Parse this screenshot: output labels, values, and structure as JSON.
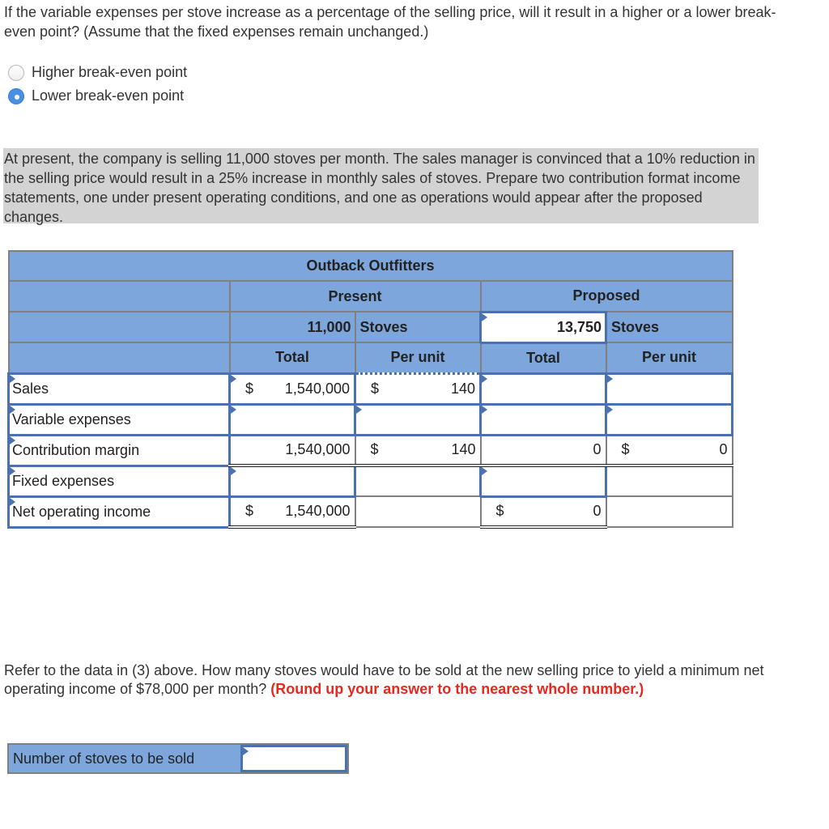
{
  "question_break_even": {
    "text": "If the variable expenses per stove increase as a percentage of the selling price, will it result in a higher or a lower break-even point? (Assume that the fixed expenses remain unchanged.)",
    "options": [
      {
        "label": "Higher break-even point",
        "selected": false
      },
      {
        "label": "Lower break-even point",
        "selected": true
      }
    ]
  },
  "instructions": "At present, the company is selling 11,000 stoves per month. The sales manager is convinced that a 10% reduction in the selling price would result in a 25% increase in monthly sales of stoves. Prepare two contribution format income statements, one under present operating conditions, and one as operations would appear after the proposed changes.",
  "income_statement": {
    "company": "Outback Outfitters",
    "present": {
      "title": "Present",
      "units": "11,000",
      "units_label": "Stoves",
      "col_total": "Total",
      "col_per_unit": "Per unit"
    },
    "proposed": {
      "title": "Proposed",
      "units": "13,750",
      "units_label": "Stoves",
      "col_total": "Total",
      "col_per_unit": "Per unit"
    },
    "currency_symbol": "$",
    "rows": [
      {
        "label": "Sales",
        "present_total": "1,540,000",
        "present_per_unit": "140",
        "proposed_total": "",
        "proposed_per_unit": ""
      },
      {
        "label": "Variable expenses",
        "present_total": "",
        "present_per_unit": "",
        "proposed_total": "",
        "proposed_per_unit": ""
      },
      {
        "label": "Contribution margin",
        "present_total": "1,540,000",
        "present_per_unit": "140",
        "proposed_total": "0",
        "proposed_per_unit": "0"
      },
      {
        "label": "Fixed expenses",
        "present_total": "",
        "present_per_unit": "",
        "proposed_total": "",
        "proposed_per_unit": ""
      },
      {
        "label": "Net operating income",
        "present_total": "1,540,000",
        "present_per_unit": "",
        "proposed_total": "0",
        "proposed_per_unit": ""
      }
    ]
  },
  "question_stoves": {
    "text": "Refer to the data in (3) above. How many stoves would have to be sold at the new selling price to yield a minimum net operating income of $78,000 per month?",
    "emphasis": "(Round up your answer to the nearest whole number.)",
    "answer_label": "Number of stoves to be sold",
    "answer_value": ""
  }
}
